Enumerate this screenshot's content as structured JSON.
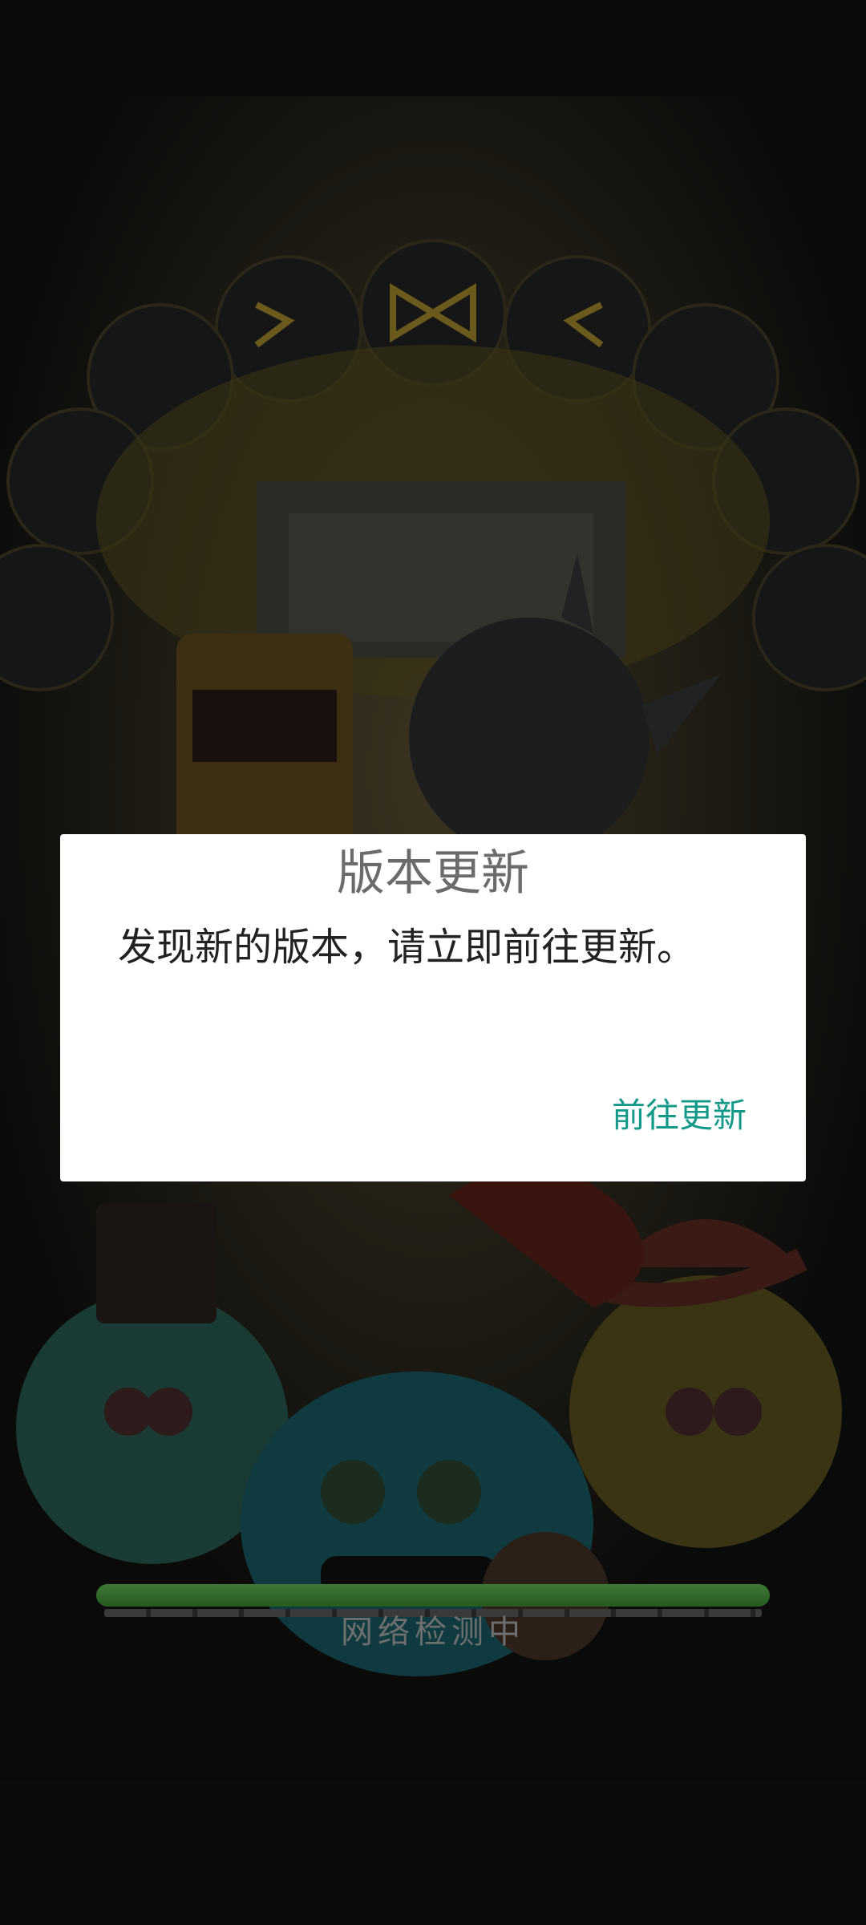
{
  "dialog": {
    "title": "版本更新",
    "message": "发现新的版本，请立即前往更新。",
    "action_label": "前往更新"
  },
  "loading": {
    "status": "网络检测中",
    "progress": 1.0
  },
  "colors": {
    "accent": "#13998a",
    "dialog_bg": "#ffffff",
    "progress_fill": "#3c7a35"
  },
  "icons": {
    "background": "game-splash-art"
  }
}
